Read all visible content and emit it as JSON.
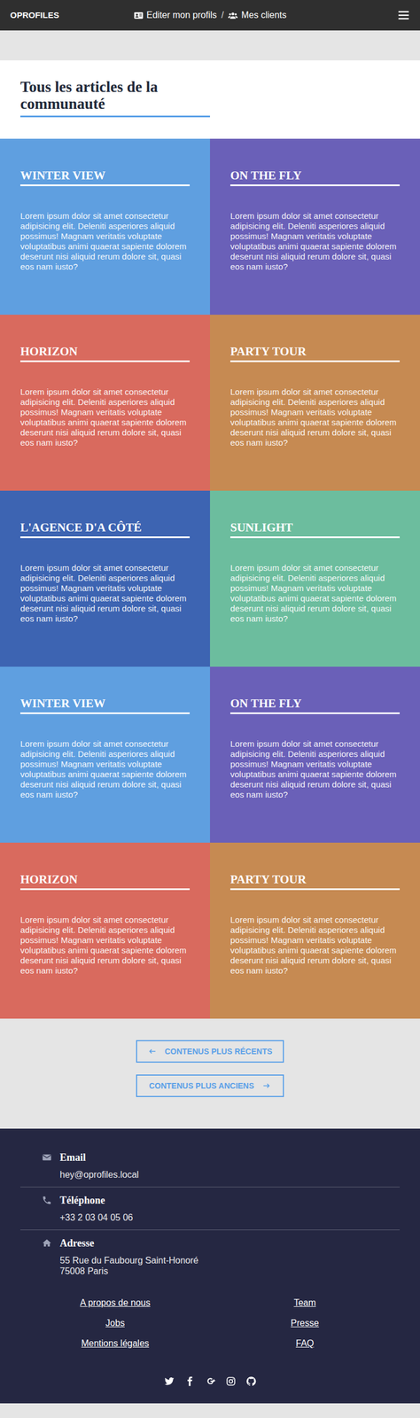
{
  "nav": {
    "brand": "OPROFILES",
    "links": [
      {
        "label": "Editer mon profils",
        "kind": "profile"
      },
      {
        "label": "Mes clients",
        "kind": "clients"
      }
    ],
    "separator": "/"
  },
  "heading": "Tous les articles de la communauté",
  "cards": [
    {
      "title": "WINTER VIEW",
      "text": "Lorem ipsum dolor sit amet consectetur adipisicing elit. Deleniti asperiores aliquid possimus! Magnam veritatis voluptate voluptatibus animi quaerat sapiente dolorem deserunt nisi aliquid rerum dolore sit, quasi eos nam iusto?",
      "color": "#5f9fe0"
    },
    {
      "title": "ON THE FLY",
      "text": "Lorem ipsum dolor sit amet consectetur adipisicing elit. Deleniti asperiores aliquid possimus! Magnam veritatis voluptate voluptatibus animi quaerat sapiente dolorem deserunt nisi aliquid rerum dolore sit, quasi eos nam iusto?",
      "color": "#6a60b8"
    },
    {
      "title": "HORIZON",
      "text": "Lorem ipsum dolor sit amet consectetur adipisicing elit. Deleniti asperiores aliquid possimus! Magnam veritatis voluptate voluptatibus animi quaerat sapiente dolorem deserunt nisi aliquid rerum dolore sit, quasi eos nam iusto?",
      "color": "#d96a5e"
    },
    {
      "title": "PARTY TOUR",
      "text": "Lorem ipsum dolor sit amet consectetur adipisicing elit. Deleniti asperiores aliquid possimus! Magnam veritatis voluptate voluptatibus animi quaerat sapiente dolorem deserunt nisi aliquid rerum dolore sit, quasi eos nam iusto?",
      "color": "#c68a52"
    },
    {
      "title": "L'AGENCE D'A CÔTÉ",
      "text": "Lorem ipsum dolor sit amet consectetur adipisicing elit. Deleniti asperiores aliquid possimus! Magnam veritatis voluptate voluptatibus animi quaerat sapiente dolorem deserunt nisi aliquid rerum dolore sit, quasi eos nam iusto?",
      "color": "#3d64b2"
    },
    {
      "title": "SUNLIGHT",
      "text": "Lorem ipsum dolor sit amet consectetur adipisicing elit. Deleniti asperiores aliquid possimus! Magnam veritatis voluptate voluptatibus animi quaerat sapiente dolorem deserunt nisi aliquid rerum dolore sit, quasi eos nam iusto?",
      "color": "#6cbd9e"
    },
    {
      "title": "WINTER VIEW",
      "text": "Lorem ipsum dolor sit amet consectetur adipisicing elit. Deleniti asperiores aliquid possimus! Magnam veritatis voluptate voluptatibus animi quaerat sapiente dolorem deserunt nisi aliquid rerum dolore sit, quasi eos nam iusto?",
      "color": "#5f9fe0"
    },
    {
      "title": "ON THE FLY",
      "text": "Lorem ipsum dolor sit amet consectetur adipisicing elit. Deleniti asperiores aliquid possimus! Magnam veritatis voluptate voluptatibus animi quaerat sapiente dolorem deserunt nisi aliquid rerum dolore sit, quasi eos nam iusto?",
      "color": "#6a60b8"
    },
    {
      "title": "HORIZON",
      "text": "Lorem ipsum dolor sit amet consectetur adipisicing elit. Deleniti asperiores aliquid possimus! Magnam veritatis voluptate voluptatibus animi quaerat sapiente dolorem deserunt nisi aliquid rerum dolore sit, quasi eos nam iusto?",
      "color": "#d96a5e"
    },
    {
      "title": "PARTY TOUR",
      "text": "Lorem ipsum dolor sit amet consectetur adipisicing elit. Deleniti asperiores aliquid possimus! Magnam veritatis voluptate voluptatibus animi quaerat sapiente dolorem deserunt nisi aliquid rerum dolore sit, quasi eos nam iusto?",
      "color": "#c68a52"
    }
  ],
  "pagination": [
    {
      "label": "CONTENUS PLUS RÉCENTS",
      "kind": "prev"
    },
    {
      "label": "CONTENUS PLUS ANCIENS",
      "kind": "next"
    }
  ],
  "footer": {
    "contacts": [
      {
        "kind": "email",
        "label": "Email",
        "lines": [
          "hey@oprofiles.local"
        ]
      },
      {
        "kind": "phone",
        "label": "Téléphone",
        "lines": [
          "+33 2 03 04 05 06"
        ]
      },
      {
        "kind": "address",
        "label": "Adresse",
        "lines": [
          "55 Rue du Faubourg Saint-Honoré",
          "75008 Paris"
        ]
      }
    ],
    "links": [
      "A propos de nous",
      "Team",
      "Jobs",
      "Presse",
      "Mentions légales",
      "FAQ"
    ]
  }
}
